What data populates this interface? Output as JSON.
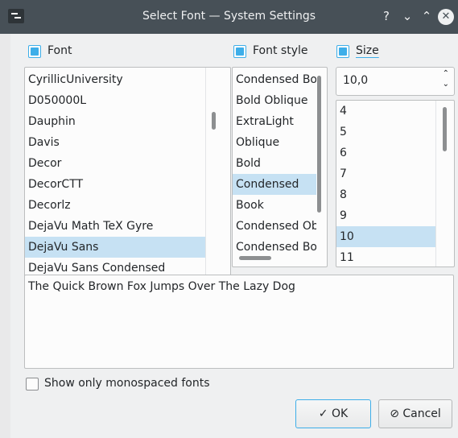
{
  "window": {
    "title": "Select Font — System Settings",
    "help_glyph": "?",
    "minimize_glyph": "⌄",
    "maximize_glyph": "⌃",
    "close_glyph": "✕"
  },
  "font_column": {
    "label": "Font",
    "checked": true,
    "items": [
      "CyrillicUniversity",
      "D050000L",
      "Dauphin",
      "Davis",
      "Decor",
      "DecorCTT",
      "Decorlz",
      "DejaVu Math TeX Gyre",
      "DejaVu Sans",
      "DejaVu Sans Condensed"
    ],
    "selected": "DejaVu Sans"
  },
  "style_column": {
    "label": "Font style",
    "checked": true,
    "items": [
      "Condensed Bold",
      "Bold Oblique",
      "ExtraLight",
      "Oblique",
      "Bold",
      "Condensed",
      "Book",
      "Condensed Oblique",
      "Condensed Bold Oblique"
    ],
    "selected": "Condensed"
  },
  "size_column": {
    "label": "Size",
    "checked": true,
    "value": "10,0",
    "items": [
      "4",
      "5",
      "6",
      "7",
      "8",
      "9",
      "10",
      "11"
    ],
    "selected": "10"
  },
  "preview": {
    "text": "The Quick Brown Fox Jumps Over The Lazy Dog"
  },
  "monospace_option": {
    "label": "Show only monospaced fonts",
    "checked": false
  },
  "buttons": {
    "ok_label": "OK",
    "ok_icon": "✓",
    "cancel_label": "Cancel",
    "cancel_icon": "⊘"
  },
  "colors": {
    "accent": "#3daee9",
    "selection": "#c6e1f3",
    "titlebar": "#475057"
  }
}
